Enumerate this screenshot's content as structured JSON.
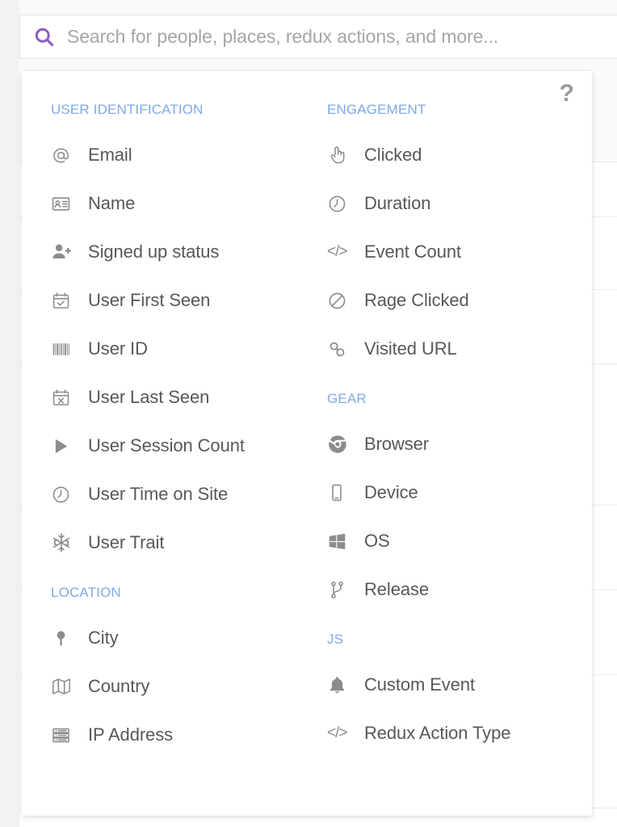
{
  "search": {
    "placeholder": "Search for people, places, redux actions, and more...",
    "value": "",
    "icon": "search-icon",
    "icon_color": "#8b5fc4"
  },
  "dropdown": {
    "help_label": "?",
    "accent_color": "#7ea9e8",
    "icon_color": "#8c8c8c",
    "label_color": "#585858",
    "columns": [
      {
        "groups": [
          {
            "title": "USER IDENTIFICATION",
            "items": [
              {
                "label": "Email",
                "icon": "at-sign-icon"
              },
              {
                "label": "Name",
                "icon": "id-card-icon"
              },
              {
                "label": "Signed up status",
                "icon": "user-plus-icon"
              },
              {
                "label": "User First Seen",
                "icon": "calendar-check-icon"
              },
              {
                "label": "User ID",
                "icon": "barcode-icon"
              },
              {
                "label": "User Last Seen",
                "icon": "calendar-x-icon"
              },
              {
                "label": "User Session Count",
                "icon": "play-triangle-icon"
              },
              {
                "label": "User Time on Site",
                "icon": "clock-icon"
              },
              {
                "label": "User Trait",
                "icon": "snowflake-icon"
              }
            ]
          },
          {
            "title": "LOCATION",
            "items": [
              {
                "label": "City",
                "icon": "map-pin-icon"
              },
              {
                "label": "Country",
                "icon": "map-fold-icon"
              },
              {
                "label": "IP Address",
                "icon": "server-stack-icon"
              }
            ]
          }
        ]
      },
      {
        "groups": [
          {
            "title": "ENGAGEMENT",
            "items": [
              {
                "label": "Clicked",
                "icon": "pointing-hand-icon"
              },
              {
                "label": "Duration",
                "icon": "clock-icon"
              },
              {
                "label": "Event Count",
                "icon": "code-brackets-icon"
              },
              {
                "label": "Rage Clicked",
                "icon": "no-entry-icon"
              },
              {
                "label": "Visited URL",
                "icon": "chain-link-icon"
              }
            ]
          },
          {
            "title": "GEAR",
            "items": [
              {
                "label": "Browser",
                "icon": "chrome-browser-icon"
              },
              {
                "label": "Device",
                "icon": "mobile-phone-icon"
              },
              {
                "label": "OS",
                "icon": "windows-logo-icon"
              },
              {
                "label": "Release",
                "icon": "git-branch-icon"
              }
            ]
          },
          {
            "title": "JS",
            "items": [
              {
                "label": "Custom Event",
                "icon": "bell-icon"
              },
              {
                "label": "Redux Action Type",
                "icon": "code-brackets-icon"
              }
            ]
          }
        ]
      }
    ]
  },
  "background": {
    "row_divider_positions": [
      200,
      268,
      358,
      450,
      625,
      730,
      835,
      1000
    ],
    "divider_color": "#ececec"
  }
}
